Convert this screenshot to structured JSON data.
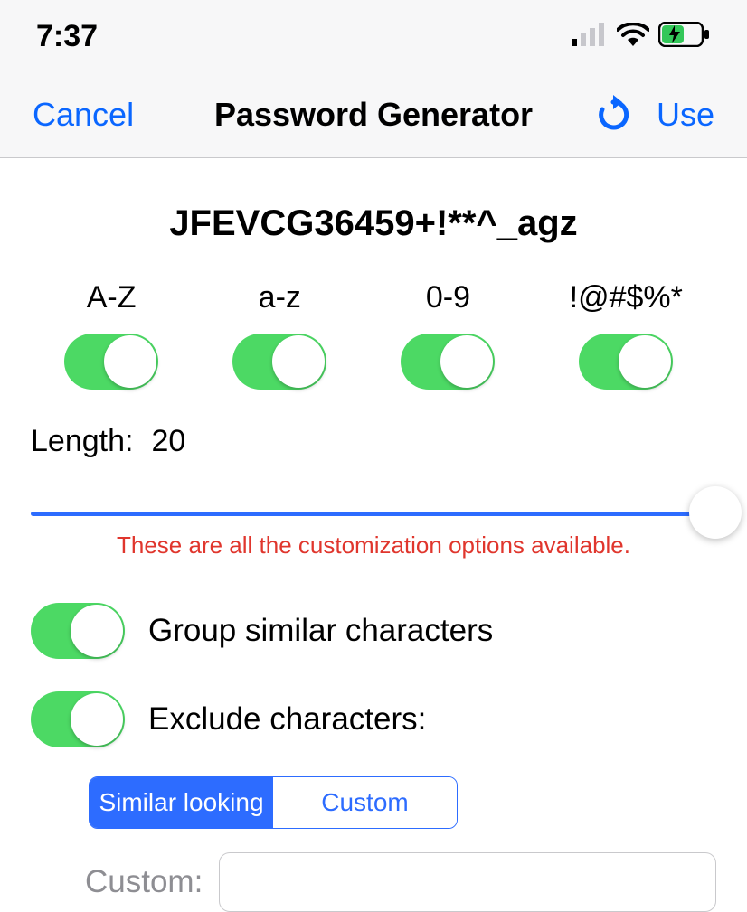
{
  "status": {
    "time": "7:37"
  },
  "nav": {
    "cancel": "Cancel",
    "title": "Password Generator",
    "use": "Use"
  },
  "password": "JFEVCG36459+!**^_agz",
  "charsets": {
    "upper": "A-Z",
    "lower": "a-z",
    "digits": "0-9",
    "symbols": "!@#$%*"
  },
  "length": {
    "label": "Length:",
    "value": "20"
  },
  "note": "These are all the customization options available.",
  "options": {
    "group": "Group similar characters",
    "exclude": "Exclude characters:"
  },
  "segmented": {
    "similar": "Similar looking",
    "custom": "Custom"
  },
  "custom": {
    "label": "Custom:",
    "value": ""
  }
}
